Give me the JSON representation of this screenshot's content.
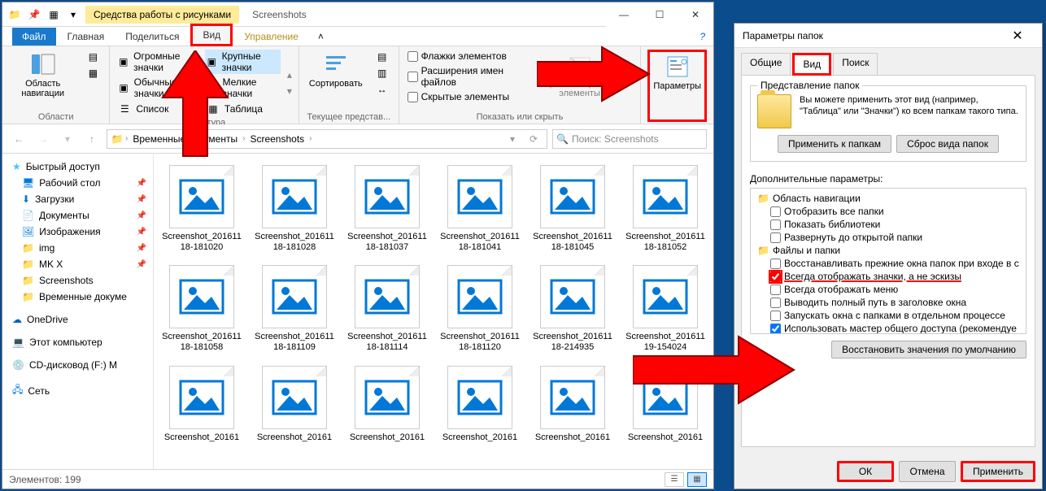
{
  "explorer": {
    "title_context": "Средства работы с рисунками",
    "title": "Screenshots",
    "tabs": {
      "file": "Файл",
      "home": "Главная",
      "share": "Поделиться",
      "view": "Вид",
      "manage": "Управление"
    },
    "ribbon": {
      "panes_group": "Области",
      "nav_pane": "Область навигации",
      "layout_group": "Структура",
      "layouts": {
        "extra_large": "Огромные значки",
        "large": "Крупные значки",
        "medium": "Обычные значки",
        "small": "Мелкие значки",
        "list": "Список",
        "tiles": "Таблица"
      },
      "current_view_group": "Текущее представ...",
      "sort": "Сортировать",
      "show_hide_group": "Показать или скрыть",
      "checkboxes": "Флажки элементов",
      "extensions": "Расширения имен файлов",
      "hidden": "Скрытые элементы",
      "hide_selected": "Скрыть выбранные элементы",
      "parameters": "Параметры"
    },
    "breadcrumb": {
      "seg1": "Временные документы",
      "seg2": "Screenshots"
    },
    "search_placeholder": "Поиск: Screenshots",
    "sidebar": {
      "quick_access": "Быстрый доступ",
      "desktop": "Рабочий стол",
      "downloads": "Загрузки",
      "documents": "Документы",
      "pictures": "Изображения",
      "img": "img",
      "mkx": "MK X",
      "screenshots": "Screenshots",
      "temp_docs": "Временные докуме",
      "onedrive": "OneDrive",
      "this_pc": "Этот компьютер",
      "cd_drive": "CD-дисковод (F:) M",
      "network": "Сеть"
    },
    "files": [
      "Screenshot_20161118-181020",
      "Screenshot_20161118-181028",
      "Screenshot_20161118-181037",
      "Screenshot_20161118-181041",
      "Screenshot_20161118-181045",
      "Screenshot_20161118-181052",
      "Screenshot_20161118-181058",
      "Screenshot_20161118-181109",
      "Screenshot_20161118-181114",
      "Screenshot_20161118-181120",
      "Screenshot_20161118-214935",
      "Screenshot_20161119-154024",
      "Screenshot_20161",
      "Screenshot_20161",
      "Screenshot_20161",
      "Screenshot_20161",
      "Screenshot_20161",
      "Screenshot_20161"
    ],
    "status": "Элементов: 199"
  },
  "dialog": {
    "title": "Параметры папок",
    "tabs": {
      "general": "Общие",
      "view": "Вид",
      "search": "Поиск"
    },
    "group_title": "Представление папок",
    "desc": "Вы можете применить этот вид (например, \"Таблица\" или \"Значки\") ко всем папкам такого типа.",
    "apply_to_folders": "Применить к папкам",
    "reset_folders": "Сброс вида папок",
    "advanced_label": "Дополнительные параметры:",
    "tree": {
      "nav_area": "Область навигации",
      "show_all": "Отобразить все папки",
      "show_libs": "Показать библиотеки",
      "expand_open": "Развернуть до открытой папки",
      "files_folders": "Файлы и папки",
      "restore_prev": "Восстанавливать прежние окна папок при входе в с",
      "always_icons": "Всегда отображать значки, а не эскизы",
      "always_menu": "Всегда отображать меню",
      "full_path": "Выводить полный путь в заголовке окна",
      "separate_process": "Запускать окна с папками в отдельном процессе",
      "use_wizard": "Использовать мастер общего доступа (рекомендуе"
    },
    "restore_defaults": "Восстановить значения по умолчанию",
    "ok": "ОК",
    "cancel": "Отмена",
    "apply": "Применить"
  }
}
